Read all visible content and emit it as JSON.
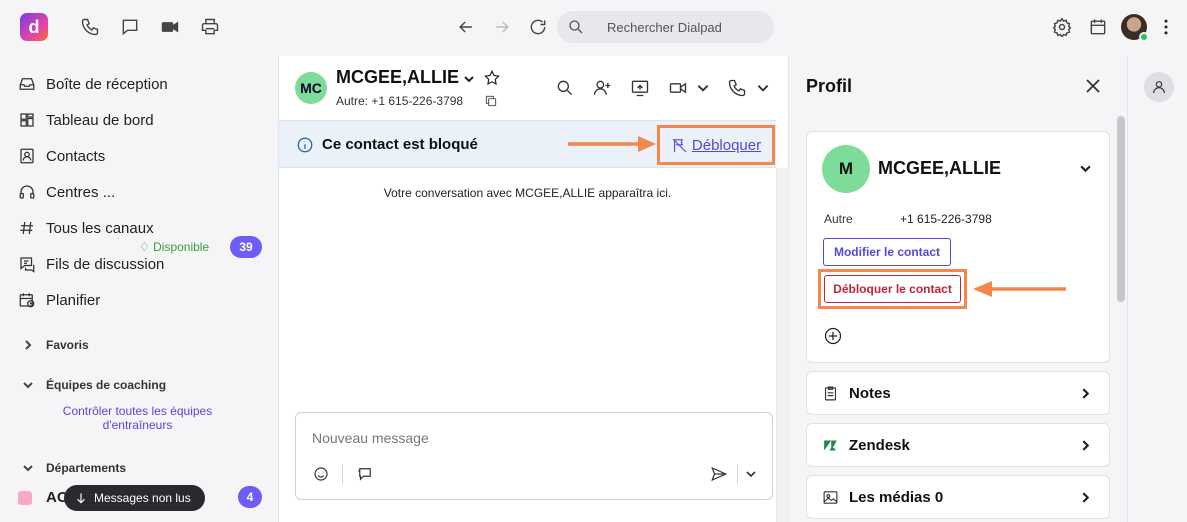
{
  "topbar": {
    "logo_letter": "d",
    "search_placeholder": "Rechercher Dialpad"
  },
  "sidebar": {
    "items": [
      {
        "label": "Boîte de réception",
        "icon": "inbox-icon"
      },
      {
        "label": "Tableau de bord",
        "icon": "dashboard-icon"
      },
      {
        "label": "Contacts",
        "icon": "contacts-icon"
      },
      {
        "label": "Centres ...",
        "icon": "headset-icon"
      },
      {
        "label": "Tous les canaux",
        "icon": "hash-icon"
      },
      {
        "label": "Fils de discussion",
        "icon": "threads-icon"
      },
      {
        "label": "Planifier",
        "icon": "calendar-clock-icon"
      }
    ],
    "center_status": "Disponible",
    "center_count": "39",
    "favorites": "Favoris",
    "coaching": "Équipes de coaching",
    "coaching_link": "Contrôler toutes les équipes d'entraîneurs",
    "departments": "Départements",
    "dept_name": "AO",
    "dept_count": "4",
    "toast": "Messages non lus"
  },
  "conversation": {
    "avatar": "MC",
    "name": "MCGEE,ALLIE",
    "subtitle": "Autre: +1 615-226-3798",
    "blocked_text": "Ce contact est bloqué",
    "unblock_link": "Débloquer",
    "empty_message": "Votre conversation avec MCGEE,ALLIE apparaîtra ici.",
    "composer_placeholder": "Nouveau message"
  },
  "profile": {
    "title": "Profil",
    "avatar": "M",
    "name": "MCGEE,ALLIE",
    "phone_label": "Autre",
    "phone_value": "+1 615-226-3798",
    "edit_button": "Modifier le contact",
    "unblock_button": "Débloquer le contact",
    "sections": [
      {
        "label": "Notes",
        "icon": "clipboard-icon"
      },
      {
        "label": "Zendesk",
        "icon": "zendesk-icon"
      },
      {
        "label": "Les médias",
        "icon": "image-icon",
        "count": "0"
      }
    ]
  },
  "colors": {
    "accent": "#5548d9",
    "badge": "#6d5cf6",
    "danger": "#c0253b",
    "annotation": "#f4874b",
    "avatar_green": "#7ddc9a"
  }
}
